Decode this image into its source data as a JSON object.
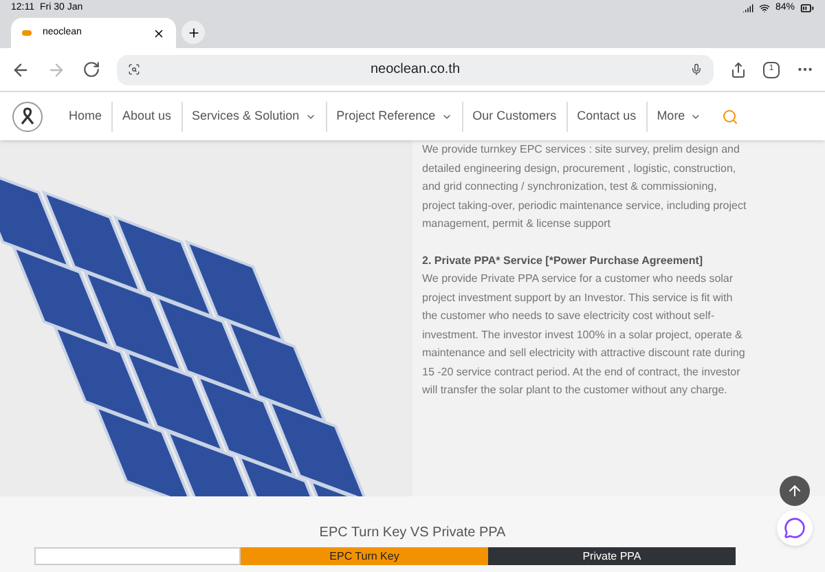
{
  "status_bar": {
    "time": "12:11",
    "date": "Fri 30 Jan",
    "battery": "84%"
  },
  "browser": {
    "tab": {
      "title": "neoclean"
    },
    "address": "neoclean.co.th",
    "tab_count": "1"
  },
  "nav": {
    "items": [
      {
        "label": "Home",
        "has_menu": false
      },
      {
        "label": "About us",
        "has_menu": false
      },
      {
        "label": "Services & Solution",
        "has_menu": true
      },
      {
        "label": "Project Reference",
        "has_menu": true
      },
      {
        "label": "Our Customers",
        "has_menu": false
      },
      {
        "label": "Contact us",
        "has_menu": false
      },
      {
        "label": "More",
        "has_menu": true
      }
    ]
  },
  "content": {
    "intro": "We provide turnkey EPC services : site survey, prelim design and detailed engineering design, procurement , logistic, construction, and grid connecting / synchronization, test & commissioning, project taking-over, periodic maintenance service, including project management, permit & license support",
    "heading": "2. Private PPA* Service [*Power Purchase Agreement]",
    "body": "We provide Private PPA service for a customer who needs solar project investment support by an Investor. This service is fit with the customer who needs to save electricity cost without self-investment. The investor invest 100% in a solar project, operate & maintenance and sell electricity with attractive discount rate during 15 -20 service contract period. At the end of contract, the investor will transfer the solar plant to the customer without any charge."
  },
  "comparison": {
    "title": "EPC Turn Key VS Private PPA",
    "columns": [
      {
        "label": "EPC Turn Key",
        "kind": "accent"
      },
      {
        "label": "Private PPA",
        "kind": "dark"
      }
    ]
  }
}
